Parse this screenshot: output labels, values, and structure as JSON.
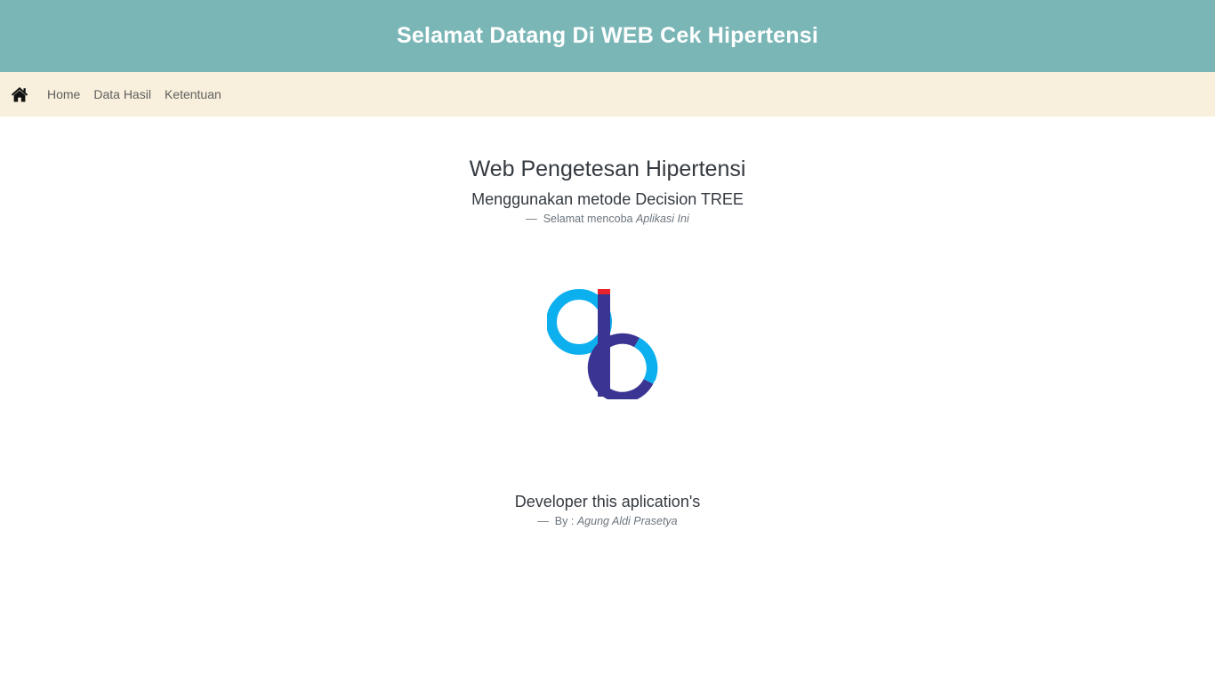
{
  "header": {
    "title": "Selamat Datang Di WEB Cek Hipertensi"
  },
  "navbar": {
    "brand_icon": "home-icon",
    "links": [
      {
        "label": "Home"
      },
      {
        "label": "Data Hasil"
      },
      {
        "label": "Ketentuan"
      }
    ]
  },
  "main": {
    "title": "Web Pengetesan Hipertensi",
    "subtitle": "Menggunakan metode Decision TREE",
    "quote_dash": "—",
    "quote_text": "Selamat mencoba",
    "quote_italic": "Aplikasi Ini",
    "logo_icon": "ab-logo",
    "developer_title": "Developer this aplication's",
    "developer_dash": "—",
    "developer_prefix": "By :",
    "developer_name": "Agung Aldi Prasetya"
  },
  "colors": {
    "banner": "#7bb6b6",
    "navbar": "#f8efdc",
    "logo_cyan": "#0db0ee",
    "logo_indigo": "#3a3592",
    "logo_red": "#e8232b"
  }
}
